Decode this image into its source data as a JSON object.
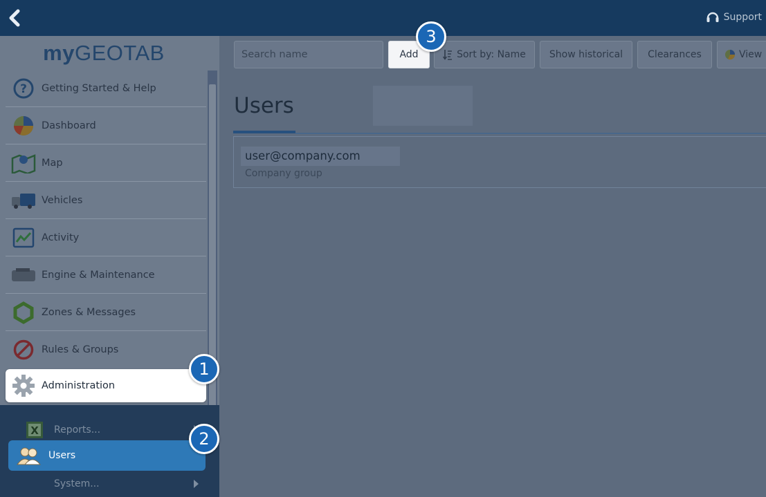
{
  "header": {
    "support_label": "Support"
  },
  "logo": {
    "my": "my",
    "geotab": "GEOTAB"
  },
  "sidebar": {
    "items": [
      {
        "label": "Getting Started & Help"
      },
      {
        "label": "Dashboard"
      },
      {
        "label": "Map"
      },
      {
        "label": "Vehicles"
      },
      {
        "label": "Activity"
      },
      {
        "label": "Engine & Maintenance"
      },
      {
        "label": "Zones & Messages"
      },
      {
        "label": "Rules & Groups"
      },
      {
        "label": "Administration"
      }
    ],
    "submenu": [
      {
        "label": "Reports..."
      },
      {
        "label": "Users"
      },
      {
        "label": "System..."
      }
    ]
  },
  "callouts": [
    "1",
    "2",
    "3"
  ],
  "toolbar": {
    "search_placeholder": "Search name",
    "add_label": "Add",
    "sort_label": "Sort by: Name",
    "historical_label": "Show historical",
    "clearances_label": "Clearances",
    "view_label": "View"
  },
  "main": {
    "title": "Users",
    "users": [
      {
        "name": "user@company.com",
        "group": "Company group"
      }
    ]
  },
  "colors": {
    "accent": "#1b67b5",
    "selected": "#2e79b7",
    "topbar": "#163a5f"
  }
}
